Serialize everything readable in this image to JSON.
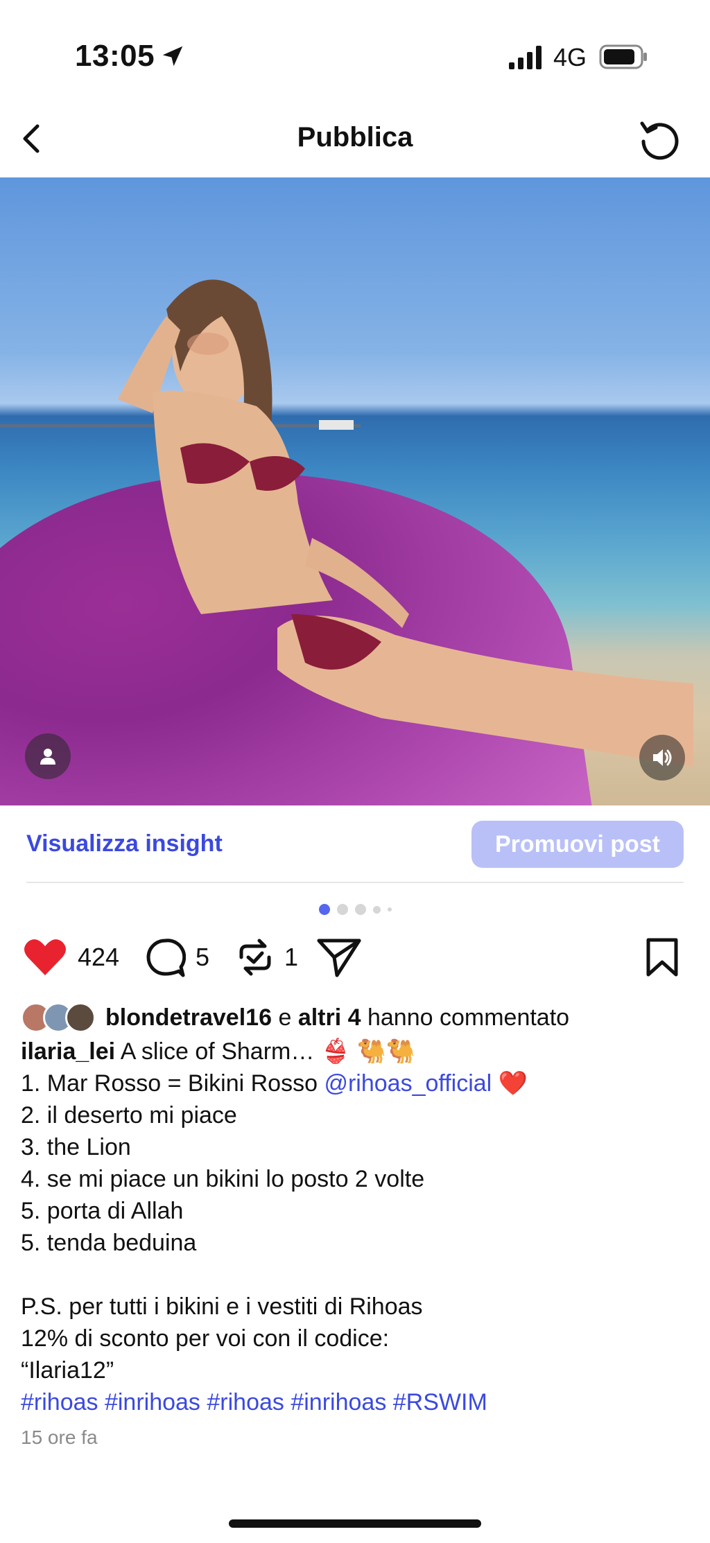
{
  "status": {
    "time": "13:05",
    "network": "4G"
  },
  "nav": {
    "title": "Pubblica"
  },
  "post": {
    "insight_label": "Visualizza insight",
    "promote_label": "Promuovi post",
    "likes": "424",
    "comments": "5",
    "reposts": "1",
    "commenters": {
      "user": "blondetravel16",
      "joiner": "e",
      "others": "altri 4",
      "suffix": "hanno commentato"
    },
    "caption": {
      "author": "ilaria_lei",
      "first_line": "A slice of Sharm… 👙 🐫🐫",
      "line1_text": "1. Mar Rosso = Bikini Rosso",
      "line1_mention": "@rihoas_official",
      "line1_emoji": "❤️",
      "line2": "2. il deserto mi piace",
      "line3": "3. the Lion",
      "line4": "4. se mi piace un bikini lo posto 2 volte",
      "line5": "5. porta di Allah",
      "line6": "5. tenda beduina",
      "ps1": "P.S. per tutti i bikini e i vestiti di Rihoas",
      "ps2": "12% di sconto per voi con il codice:",
      "ps3": "“Ilaria12”",
      "hashtags": "#rihoas #inrihoas #rihoas #inrihoas #RSWIM"
    },
    "time_ago": "15 ore fa"
  },
  "colors": {
    "accent": "#3b49df",
    "promote_bg": "#b9c0f7",
    "like": "#e8232f",
    "dot_active": "#5766ef"
  },
  "icons": [
    "location-arrow-icon",
    "signal-icon",
    "battery-icon",
    "back-chevron-icon",
    "refresh-icon",
    "user-tag-icon",
    "sound-icon",
    "heart-icon",
    "comment-icon",
    "repost-icon",
    "send-icon",
    "bookmark-icon"
  ],
  "carousel": {
    "count": 5,
    "active_index": 0
  }
}
